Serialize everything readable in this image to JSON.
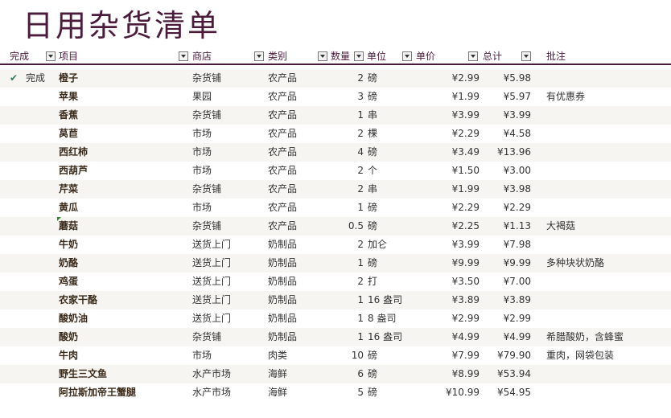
{
  "title": "日用杂货清单",
  "colors": {
    "title": "#4b1b3c",
    "accent": "#4b1b3c",
    "check": "#3a7a5a",
    "shade": "#f6f5f1"
  },
  "headers": {
    "done": "完成",
    "item": "项目",
    "store": "商店",
    "category": "类别",
    "qty": "数量",
    "unit": "单位",
    "price": "单价",
    "total": "总计",
    "notes": "批注"
  },
  "rows": [
    {
      "done": "完成",
      "item": "橙子",
      "store": "杂货铺",
      "category": "农产品",
      "qty": "2",
      "unit": "磅",
      "price": "¥2.99",
      "total": "¥5.98",
      "notes": ""
    },
    {
      "done": "",
      "item": "苹果",
      "store": "果园",
      "category": "农产品",
      "qty": "3",
      "unit": "磅",
      "price": "¥1.99",
      "total": "¥5.97",
      "notes": "有优惠券"
    },
    {
      "done": "",
      "item": "香蕉",
      "store": "杂货铺",
      "category": "农产品",
      "qty": "1",
      "unit": "串",
      "price": "¥3.99",
      "total": "¥3.99",
      "notes": ""
    },
    {
      "done": "",
      "item": "莴苣",
      "store": "市场",
      "category": "农产品",
      "qty": "2",
      "unit": "棵",
      "price": "¥2.29",
      "total": "¥4.58",
      "notes": ""
    },
    {
      "done": "",
      "item": "西红柿",
      "store": "市场",
      "category": "农产品",
      "qty": "4",
      "unit": "磅",
      "price": "¥3.49",
      "total": "¥13.96",
      "notes": ""
    },
    {
      "done": "",
      "item": "西葫芦",
      "store": "市场",
      "category": "农产品",
      "qty": "2",
      "unit": "个",
      "price": "¥1.50",
      "total": "¥3.00",
      "notes": ""
    },
    {
      "done": "",
      "item": "芹菜",
      "store": "杂货铺",
      "category": "农产品",
      "qty": "2",
      "unit": "串",
      "price": "¥1.99",
      "total": "¥3.98",
      "notes": ""
    },
    {
      "done": "",
      "item": "黄瓜",
      "store": "市场",
      "category": "农产品",
      "qty": "1",
      "unit": "磅",
      "price": "¥2.29",
      "total": "¥2.29",
      "notes": ""
    },
    {
      "done": "",
      "item": "蘑菇",
      "store": "杂货铺",
      "category": "农产品",
      "qty": "0.5",
      "unit": "磅",
      "price": "¥2.25",
      "total": "¥1.13",
      "notes": "大褐菇"
    },
    {
      "done": "",
      "item": "牛奶",
      "store": "送货上门",
      "category": "奶制品",
      "qty": "2",
      "unit": "加仑",
      "price": "¥3.99",
      "total": "¥7.98",
      "notes": ""
    },
    {
      "done": "",
      "item": "奶酪",
      "store": "送货上门",
      "category": "奶制品",
      "qty": "1",
      "unit": "磅",
      "price": "¥9.99",
      "total": "¥9.99",
      "notes": "多种块状奶酪"
    },
    {
      "done": "",
      "item": "鸡蛋",
      "store": "送货上门",
      "category": "奶制品",
      "qty": "2",
      "unit": "打",
      "price": "¥3.50",
      "total": "¥7.00",
      "notes": ""
    },
    {
      "done": "",
      "item": "农家干酪",
      "store": "送货上门",
      "category": "奶制品",
      "qty": "1",
      "unit": "16 盎司",
      "price": "¥3.89",
      "total": "¥3.89",
      "notes": ""
    },
    {
      "done": "",
      "item": "酸奶油",
      "store": "送货上门",
      "category": "奶制品",
      "qty": "1",
      "unit": "8 盎司",
      "price": "¥2.99",
      "total": "¥2.99",
      "notes": ""
    },
    {
      "done": "",
      "item": "酸奶",
      "store": "杂货铺",
      "category": "奶制品",
      "qty": "1",
      "unit": "16 盎司",
      "price": "¥4.99",
      "total": "¥4.99",
      "notes": "希腊酸奶，含蜂蜜"
    },
    {
      "done": "",
      "item": "牛肉",
      "store": "市场",
      "category": "肉类",
      "qty": "10",
      "unit": "磅",
      "price": "¥7.99",
      "total": "¥79.90",
      "notes": "重肉，网袋包装"
    },
    {
      "done": "",
      "item": "野生三文鱼",
      "store": "水产市场",
      "category": "海鲜",
      "qty": "6",
      "unit": "磅",
      "price": "¥8.99",
      "total": "¥53.94",
      "notes": ""
    },
    {
      "done": "",
      "item": "阿拉斯加帝王蟹腿",
      "store": "水产市场",
      "category": "海鲜",
      "qty": "5",
      "unit": "磅",
      "price": "¥10.99",
      "total": "¥54.95",
      "notes": ""
    }
  ]
}
